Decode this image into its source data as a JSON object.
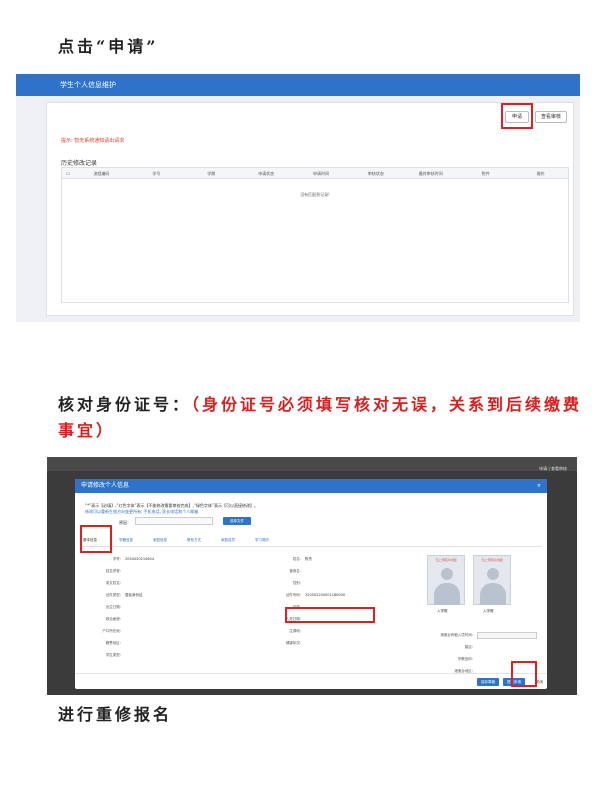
{
  "headings": {
    "step1": "点击“申请”",
    "step2_black": "核对身份证号：",
    "step2_red": "（身份证号必须填写核对无误，关系到后续缴费事宜）",
    "step3": "进行重修报名"
  },
  "screenshot1": {
    "page_title": "学生个人信息维护",
    "apply_button": "申请",
    "review_button": "查看审核",
    "tip": "提示: 暂无系统通知请出请求",
    "history_title": "历史修改记录",
    "columns": [
      "流程编码",
      "学号",
      "学期",
      "申请状态",
      "申请时间",
      "审核状态",
      "最终审核时间",
      "附件",
      "操作"
    ],
    "empty_text": "没有匹配到记录!",
    "colors": {
      "topbar": "#2e73c9",
      "highlight": "#e02020",
      "tip": "#d9412c"
    }
  },
  "screenshot2": {
    "bg_buttons": "申请 | 查看审核",
    "modal_title": "申请修改个人信息",
    "close_icon": "×",
    "note1": "“*”表示【必填】,“红色字体”表示【不能修改需要审核完成】,“绿色字体”表示【可以直接修改】。",
    "note2": "修改可以重新生效方向变更所有: 手机电话, 家长电话和个人邮箱",
    "reason_label": "原因：",
    "upload_button": "选择文件",
    "tabs": [
      "基本信息",
      "学籍信息",
      "家庭信息",
      "联系方式",
      "家庭成员",
      "学习简历"
    ],
    "fields": [
      [
        {
          "label": "学号:",
          "value": "2054020210604"
        },
        {
          "label": "姓名:",
          "value": "陈杰"
        }
      ],
      [
        {
          "label": "姓名拼音:",
          "value": ""
        },
        {
          "label": "曾用名:",
          "value": ""
        }
      ],
      [
        {
          "label": "英文姓名:",
          "value": ""
        },
        {
          "label": "性别:",
          "value": ""
        }
      ],
      [
        {
          "label": "证件类型:",
          "value": "居民身份证"
        },
        {
          "label": "证件号码:",
          "value": "320502200001160000"
        }
      ],
      [
        {
          "label": "出生日期:",
          "value": ""
        },
        {
          "label": "民族:",
          "value": ""
        }
      ],
      [
        {
          "label": "政治面貌:",
          "value": ""
        },
        {
          "label": "入党日期:",
          "value": ""
        }
      ],
      [
        {
          "label": "户口所在地:",
          "value": ""
        },
        {
          "label": "生源地:",
          "value": ""
        }
      ],
      [
        {
          "label": "籍贯地区:",
          "value": ""
        },
        {
          "label": "健康状况:",
          "value": ""
        }
      ],
      [
        {
          "label": "学生类型:",
          "value": ""
        },
        {
          "label": "",
          "value": ""
        }
      ]
    ],
    "photo_title": "无上传照片的图",
    "photo_labels": [
      "入学照",
      "入学照"
    ],
    "right_form": [
      {
        "label": "港澳台侨胞入境时间:"
      },
      {
        "label": "婚否:"
      },
      {
        "label": "宗教信仰:"
      },
      {
        "label": "港澳台地区:"
      }
    ],
    "footer_buttons": {
      "save": "保存草稿",
      "submit": "提交申请",
      "close": "关闭"
    }
  }
}
